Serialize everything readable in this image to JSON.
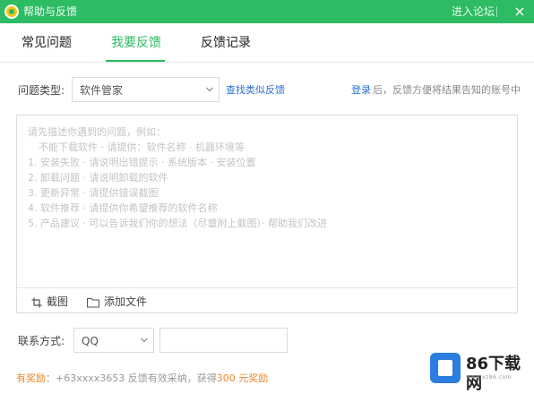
{
  "window": {
    "title": "帮助与反馈",
    "forum_link": "进入论坛",
    "close_glyph": "×",
    "accent_color": "#2dbb63"
  },
  "tabs": [
    {
      "label": "常见问题",
      "active": false
    },
    {
      "label": "我要反馈",
      "active": true
    },
    {
      "label": "反馈记录",
      "active": false
    }
  ],
  "problem_type": {
    "label": "问题类型:",
    "selected": "软件管家",
    "find_similar": "查找类似反馈"
  },
  "login_hint": {
    "link": "登录",
    "text": "后，反馈方便将结果告知的账号中"
  },
  "description": {
    "placeholder_lines": [
      "请先描述你遇到的问题，例如：",
      "不能下载软件 · 请提供：软件名称 · 机器环境等",
      "1. 安装失败 · 请说明出错提示 · 系统版本 · 安装位置",
      "2. 卸载问题 · 请说明卸载的软件",
      "3. 更新异常 · 请提供错误截图",
      "4. 软件推荐 · 请提供你希望推荐的软件名称",
      "5. 产品建议 · 可以告诉我们你的想法（尽量附上截图）· 帮助我们改进"
    ],
    "screenshot_label": "截图",
    "attach_label": "添加文件"
  },
  "contact": {
    "label": "联系方式:",
    "type": "QQ",
    "value": ""
  },
  "footer": {
    "highlight": "有奖励",
    "text": "：+63xxxx3653 反馈有效采纳，获得",
    "reward": "300 元奖励"
  },
  "watermark": {
    "brand": "86下载网",
    "url": "www.xz86.com"
  }
}
